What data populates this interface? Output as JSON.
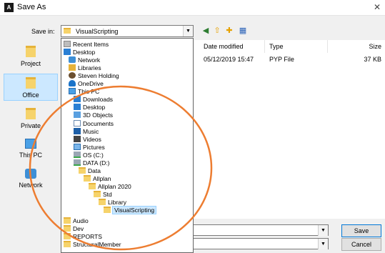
{
  "window": {
    "title": "Save As",
    "app_icon_letter": "A"
  },
  "save_in": {
    "label": "Save in:",
    "value": "VisualScripting"
  },
  "places": [
    {
      "label": "Project"
    },
    {
      "label": "Office"
    },
    {
      "label": "Private"
    },
    {
      "label": "This PC"
    },
    {
      "label": "Network"
    }
  ],
  "columns": {
    "date": "Date modified",
    "type": "Type",
    "size": "Size"
  },
  "file_row": {
    "date": "05/12/2019 15:47",
    "type": "PYP File",
    "size": "37 KB"
  },
  "dropdown": [
    {
      "label": "Recent Items",
      "icon": "recent-items-icon",
      "indent": 0
    },
    {
      "label": "Desktop",
      "icon": "desktop-icon",
      "indent": 0
    },
    {
      "label": "Network",
      "icon": "network-icon",
      "indent": 1
    },
    {
      "label": "Libraries",
      "icon": "libraries-icon",
      "indent": 1
    },
    {
      "label": "Steven Holding",
      "icon": "user-icon",
      "indent": 1
    },
    {
      "label": "OneDrive",
      "icon": "onedrive-icon",
      "indent": 1
    },
    {
      "label": "This PC",
      "icon": "this-pc-icon",
      "indent": 1
    },
    {
      "label": "Downloads",
      "icon": "downloads-icon",
      "indent": 2
    },
    {
      "label": "Desktop",
      "icon": "desktop-icon",
      "indent": 2
    },
    {
      "label": "3D Objects",
      "icon": "3d-objects-icon",
      "indent": 2
    },
    {
      "label": "Documents",
      "icon": "documents-icon",
      "indent": 2
    },
    {
      "label": "Music",
      "icon": "music-icon",
      "indent": 2
    },
    {
      "label": "Videos",
      "icon": "videos-icon",
      "indent": 2
    },
    {
      "label": "Pictures",
      "icon": "pictures-icon",
      "indent": 2
    },
    {
      "label": "OS (C:)",
      "icon": "drive-icon",
      "indent": 2
    },
    {
      "label": "DATA (D:)",
      "icon": "drive-icon",
      "indent": 2
    },
    {
      "label": "Data",
      "icon": "folder-icon",
      "indent": 3
    },
    {
      "label": "Allplan",
      "icon": "folder-icon",
      "indent": 4
    },
    {
      "label": "Allplan 2020",
      "icon": "folder-icon",
      "indent": 5
    },
    {
      "label": "Std",
      "icon": "folder-icon",
      "indent": 6
    },
    {
      "label": "Library",
      "icon": "folder-icon",
      "indent": 7
    },
    {
      "label": "VisualScripting",
      "icon": "folder-icon",
      "indent": 8,
      "selected": true
    },
    {
      "label": "Audio",
      "icon": "folder-icon",
      "indent": 0
    },
    {
      "label": "Dev",
      "icon": "folder-icon",
      "indent": 0
    },
    {
      "label": "REPORTS",
      "icon": "folder-icon",
      "indent": 0
    },
    {
      "label": "StructuralMember",
      "icon": "folder-icon",
      "indent": 0
    }
  ],
  "buttons": {
    "save": "Save",
    "cancel": "Cancel"
  },
  "colors": {
    "annotation": "#ed7d31",
    "selection": "#cce8ff"
  }
}
